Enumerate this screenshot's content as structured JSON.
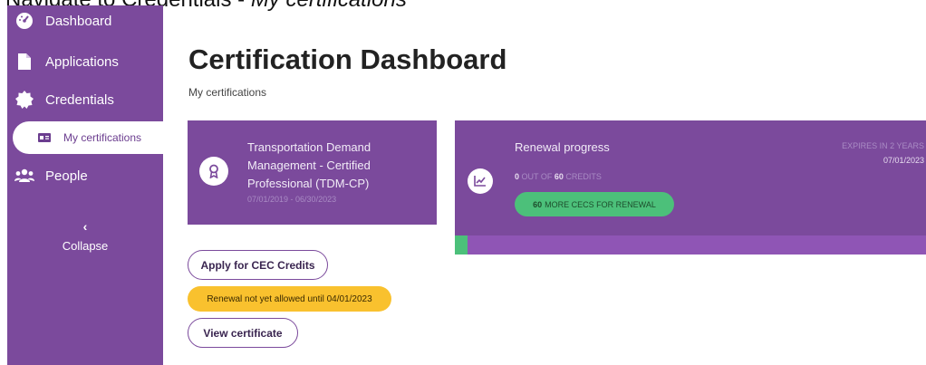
{
  "caption": {
    "prefix": "Navigate to Credentials -",
    "emphasis": "My certifications"
  },
  "sidebar": {
    "items": [
      {
        "label": "Dashboard",
        "icon": "dashboard-icon"
      },
      {
        "label": "Applications",
        "icon": "document-icon"
      },
      {
        "label": "Credentials",
        "icon": "seal-icon"
      },
      {
        "label": "My certifications",
        "icon": "id-card-icon",
        "active": true
      },
      {
        "label": "People",
        "icon": "people-icon"
      }
    ],
    "collapse_label": "Collapse",
    "collapse_chevron": "‹"
  },
  "main": {
    "title": "Certification Dashboard",
    "breadcrumb": "My certifications"
  },
  "certification": {
    "name": "Transportation Demand Management - Certified Professional (TDM-CP)",
    "dates": "07/01/2019 - 06/30/2023",
    "icon": "award-icon"
  },
  "renewal": {
    "title": "Renewal progress",
    "credits_earned": "0",
    "credits_out_of": "OUT OF",
    "credits_required": "60",
    "credits_suffix": "CREDITS",
    "progress_fraction": 0.0,
    "pill_count": "60",
    "pill_text": "MORE CECS FOR RENEWAL",
    "expires_label": "EXPIRES IN 2 YEARS",
    "expires_date": "07/01/2023",
    "icon": "chart-icon"
  },
  "actions": {
    "apply_label": "Apply for CEC Credits",
    "notice": "Renewal not yet allowed until 04/01/2023",
    "view_label": "View certificate"
  },
  "colors": {
    "brand_purple": "#7b4a9c",
    "progress_green": "#4cc07a",
    "notice_yellow": "#f9c12e"
  }
}
